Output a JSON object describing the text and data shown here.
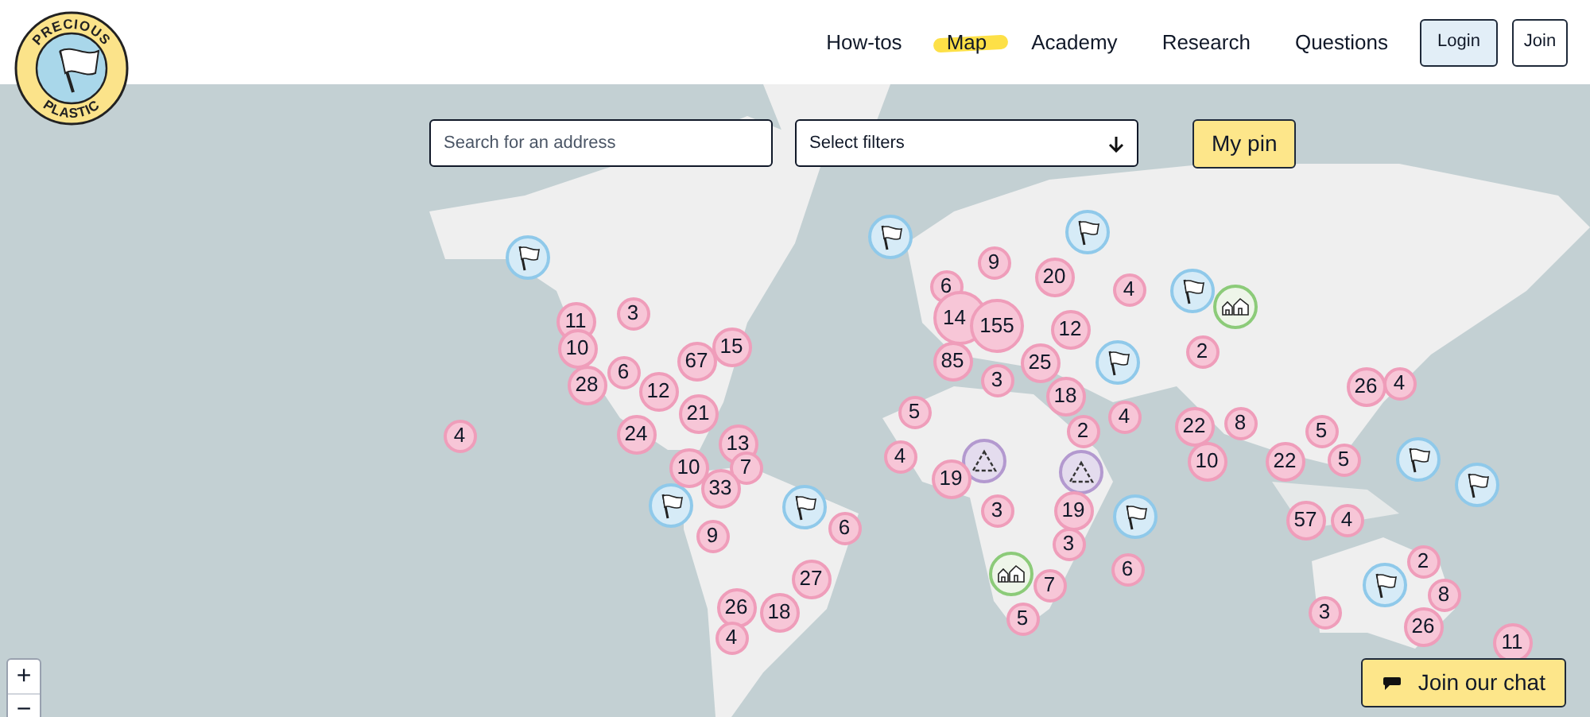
{
  "logo": {
    "top_text": "PRECIOUS",
    "bottom_text": "PLASTIC"
  },
  "nav": [
    {
      "label": "How-tos",
      "selected": false
    },
    {
      "label": "Map",
      "selected": true
    },
    {
      "label": "Academy",
      "selected": false
    },
    {
      "label": "Research",
      "selected": false
    },
    {
      "label": "Questions",
      "selected": false
    }
  ],
  "account_buttons": [
    "Login",
    "Join"
  ],
  "search": {
    "placeholder": "Search for an address"
  },
  "filters": {
    "label": "Select filters"
  },
  "my_pin_button": "My pin",
  "markers": [
    {
      "kind": "flag"
    },
    {
      "kind": "flag"
    },
    {
      "kind": "flag"
    },
    {
      "kind": "flag"
    },
    {
      "kind": "flag"
    },
    {
      "kind": "flag"
    },
    {
      "kind": "flag"
    },
    {
      "kind": "flag"
    },
    {
      "kind": "flag"
    },
    {
      "kind": "flag"
    },
    {
      "kind": "flag"
    },
    {
      "kind": "house"
    },
    {
      "kind": "house"
    },
    {
      "kind": "recycle"
    },
    {
      "kind": "recycle"
    },
    {
      "kind": "cluster",
      "count": "3"
    },
    {
      "kind": "cluster",
      "count": "11"
    },
    {
      "kind": "cluster",
      "count": "10"
    },
    {
      "kind": "cluster",
      "count": "28"
    },
    {
      "kind": "cluster",
      "count": "6"
    },
    {
      "kind": "cluster",
      "count": "12"
    },
    {
      "kind": "cluster",
      "count": "67"
    },
    {
      "kind": "cluster",
      "count": "15"
    },
    {
      "kind": "cluster",
      "count": "21"
    },
    {
      "kind": "cluster",
      "count": "24"
    },
    {
      "kind": "cluster",
      "count": "13"
    },
    {
      "kind": "cluster",
      "count": "10"
    },
    {
      "kind": "cluster",
      "count": "7"
    },
    {
      "kind": "cluster",
      "count": "33"
    },
    {
      "kind": "cluster",
      "count": "9"
    },
    {
      "kind": "cluster",
      "count": "6"
    },
    {
      "kind": "cluster",
      "count": "27"
    },
    {
      "kind": "cluster",
      "count": "26"
    },
    {
      "kind": "cluster",
      "count": "18"
    },
    {
      "kind": "cluster",
      "count": "4"
    },
    {
      "kind": "cluster",
      "count": "4"
    },
    {
      "kind": "cluster",
      "count": "9"
    },
    {
      "kind": "cluster",
      "count": "6"
    },
    {
      "kind": "cluster",
      "count": "20"
    },
    {
      "kind": "cluster",
      "count": "4"
    },
    {
      "kind": "cluster",
      "count": "14"
    },
    {
      "kind": "cluster",
      "count": "155"
    },
    {
      "kind": "cluster",
      "count": "12"
    },
    {
      "kind": "cluster",
      "count": "85"
    },
    {
      "kind": "cluster",
      "count": "25"
    },
    {
      "kind": "cluster",
      "count": "3"
    },
    {
      "kind": "cluster",
      "count": "18"
    },
    {
      "kind": "cluster",
      "count": "5"
    },
    {
      "kind": "cluster",
      "count": "4"
    },
    {
      "kind": "cluster",
      "count": "2"
    },
    {
      "kind": "cluster",
      "count": "4"
    },
    {
      "kind": "cluster",
      "count": "19"
    },
    {
      "kind": "cluster",
      "count": "3"
    },
    {
      "kind": "cluster",
      "count": "19"
    },
    {
      "kind": "cluster",
      "count": "3"
    },
    {
      "kind": "cluster",
      "count": "6"
    },
    {
      "kind": "cluster",
      "count": "7"
    },
    {
      "kind": "cluster",
      "count": "5"
    },
    {
      "kind": "cluster",
      "count": "2"
    },
    {
      "kind": "cluster",
      "count": "26"
    },
    {
      "kind": "cluster",
      "count": "4"
    },
    {
      "kind": "cluster",
      "count": "22"
    },
    {
      "kind": "cluster",
      "count": "8"
    },
    {
      "kind": "cluster",
      "count": "5"
    },
    {
      "kind": "cluster",
      "count": "10"
    },
    {
      "kind": "cluster",
      "count": "22"
    },
    {
      "kind": "cluster",
      "count": "5"
    },
    {
      "kind": "cluster",
      "count": "57"
    },
    {
      "kind": "cluster",
      "count": "4"
    },
    {
      "kind": "cluster",
      "count": "2"
    },
    {
      "kind": "cluster",
      "count": "8"
    },
    {
      "kind": "cluster",
      "count": "3"
    },
    {
      "kind": "cluster",
      "count": "26"
    },
    {
      "kind": "cluster",
      "count": "11"
    }
  ],
  "zoom_controls": [
    "+",
    "−"
  ],
  "chat_button": "Join our chat"
}
